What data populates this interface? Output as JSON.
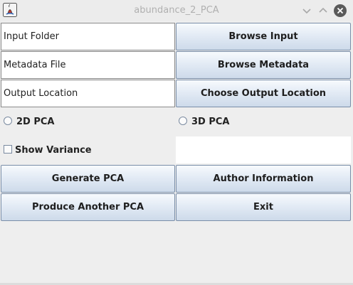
{
  "window": {
    "title": "abundance_2_PCA",
    "app_icon": "java-app-icon",
    "controls": [
      "minimize-icon",
      "maximize-icon",
      "close-icon"
    ]
  },
  "fields": {
    "input_folder": "Input Folder",
    "metadata_file": "Metadata File",
    "output_location": "Output Location"
  },
  "buttons": {
    "browse_input": "Browse Input",
    "browse_metadata": "Browse Metadata",
    "choose_output": "Choose Output Location",
    "generate_pca": "Generate PCA",
    "author_info": "Author Information",
    "produce_another": "Produce Another PCA",
    "exit": "Exit"
  },
  "options": {
    "pca_2d": {
      "label": "2D PCA",
      "selected": false
    },
    "pca_3d": {
      "label": "3D PCA",
      "selected": false
    },
    "show_variance": {
      "label": "Show Variance",
      "checked": false
    }
  },
  "colors": {
    "button_border": "#7a8ea8",
    "close_button": "#5a5a5a"
  }
}
